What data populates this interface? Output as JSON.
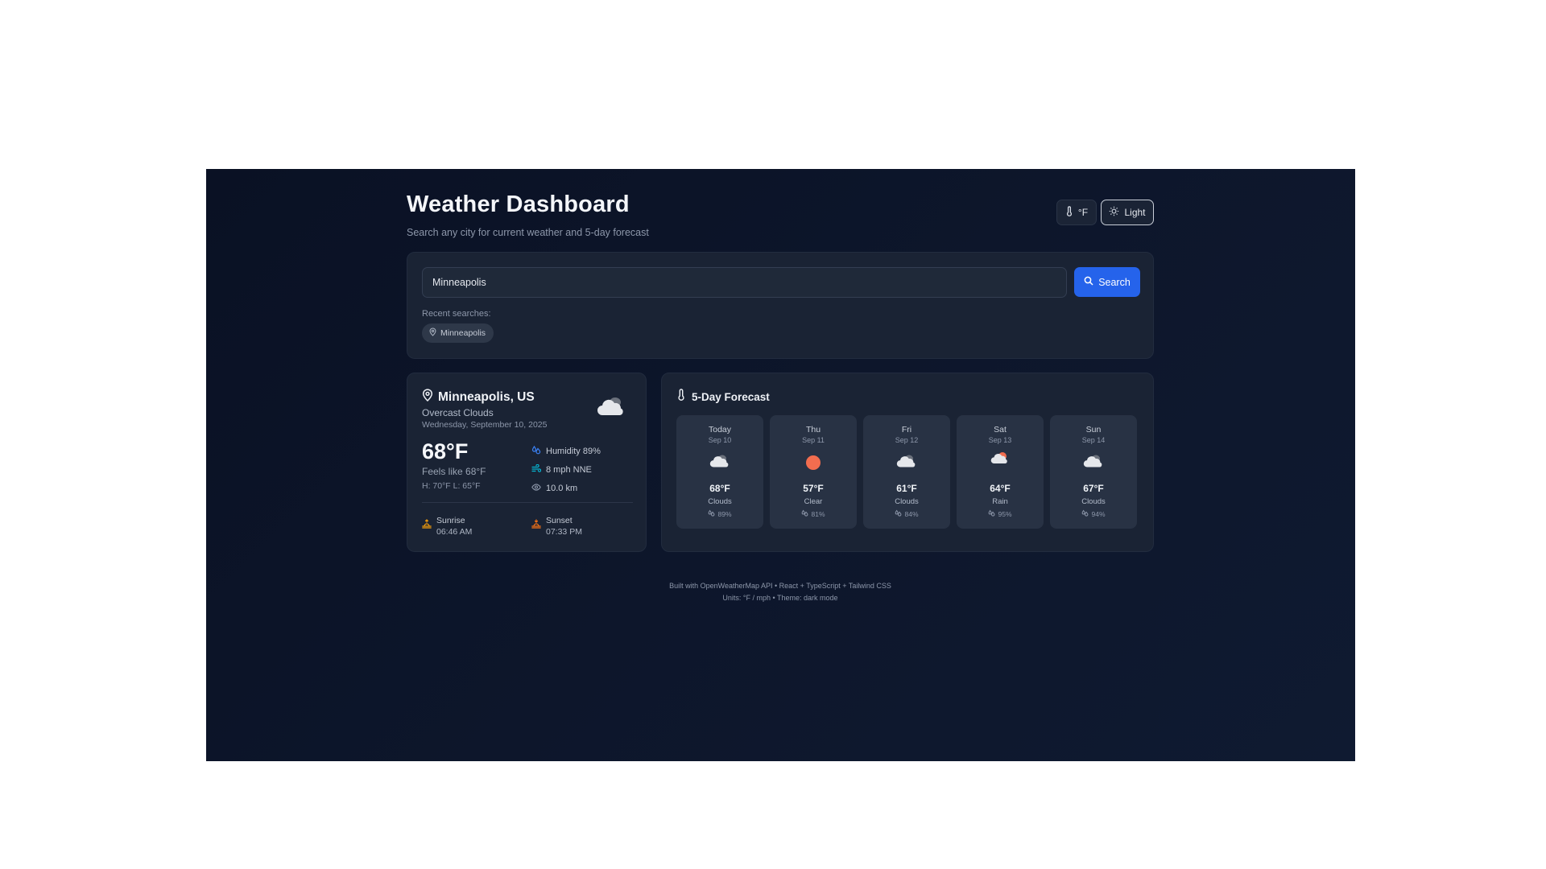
{
  "header": {
    "title": "Weather Dashboard",
    "subtitle": "Search any city for current weather and 5-day forecast",
    "unit_label": "°F",
    "theme_label": "Light"
  },
  "search": {
    "value": "Minneapolis",
    "button_label": "Search",
    "recent_label": "Recent searches:",
    "recent": [
      "Minneapolis"
    ]
  },
  "current": {
    "location": "Minneapolis, US",
    "condition": "Overcast Clouds",
    "date": "Wednesday, September 10, 2025",
    "temp": "68°F",
    "feels_like": "Feels like 68°F",
    "hi_lo": "H: 70°F L: 65°F",
    "humidity": "Humidity 89%",
    "wind": "8 mph NNE",
    "visibility": "10.0 km",
    "sunrise_label": "Sunrise",
    "sunrise_time": "06:46 AM",
    "sunset_label": "Sunset",
    "sunset_time": "07:33 PM",
    "icon": "cloud-icon"
  },
  "forecast": {
    "title": "5-Day Forecast",
    "days": [
      {
        "day": "Today",
        "date": "Sep 10",
        "temp": "68°F",
        "desc": "Clouds",
        "humidity": "89%",
        "icon": "cloud-icon"
      },
      {
        "day": "Thu",
        "date": "Sep 11",
        "temp": "57°F",
        "desc": "Clear",
        "humidity": "81%",
        "icon": "sun-icon"
      },
      {
        "day": "Fri",
        "date": "Sep 12",
        "temp": "61°F",
        "desc": "Clouds",
        "humidity": "84%",
        "icon": "cloud-icon"
      },
      {
        "day": "Sat",
        "date": "Sep 13",
        "temp": "64°F",
        "desc": "Rain",
        "humidity": "95%",
        "icon": "rain-cloud-icon"
      },
      {
        "day": "Sun",
        "date": "Sep 14",
        "temp": "67°F",
        "desc": "Clouds",
        "humidity": "94%",
        "icon": "cloud-icon"
      }
    ]
  },
  "footer": {
    "line1": "Built with OpenWeatherMap API • React + TypeScript + Tailwind CSS",
    "line2": "Units: °F / mph • Theme: dark mode"
  },
  "colors": {
    "accent": "#2563eb",
    "sun": "#f26d4f",
    "sunrise": "#f59e0b",
    "sunset": "#f97316",
    "humidity": "#3b82f6",
    "wind": "#06b6d4"
  }
}
